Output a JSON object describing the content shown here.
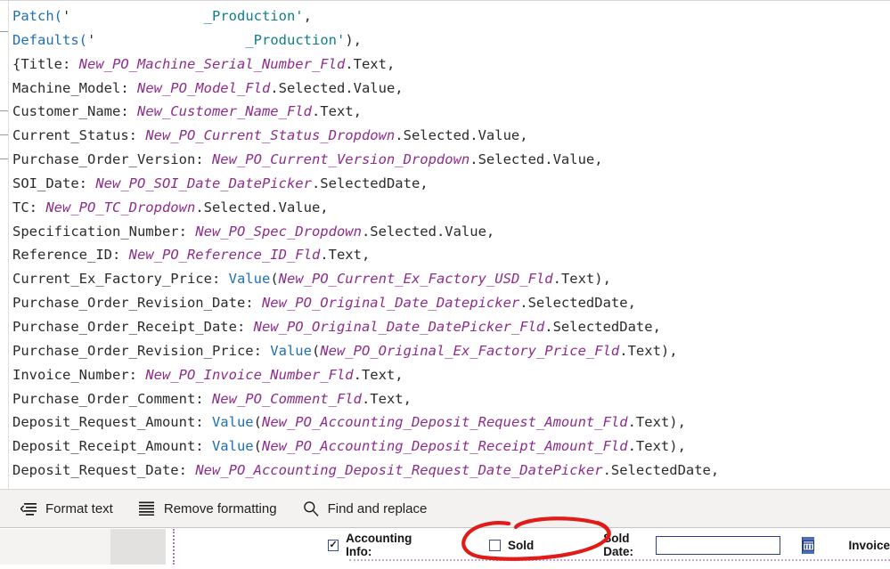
{
  "app": {
    "surface": "powerapps-formula-bar"
  },
  "formula": {
    "language": "Power Fx",
    "lines": [
      [
        {
          "t": "Patch(",
          "c": "fn"
        },
        {
          "t": "'",
          "c": "plain"
        },
        {
          "t": "                ",
          "c": "redact"
        },
        {
          "t": "_Production'",
          "c": "str"
        },
        {
          "t": ",",
          "c": "plain"
        }
      ],
      [
        {
          "t": "Defaults(",
          "c": "fn"
        },
        {
          "t": "'",
          "c": "plain"
        },
        {
          "t": "                  ",
          "c": "redact"
        },
        {
          "t": "_Production'",
          "c": "str"
        },
        {
          "t": "),",
          "c": "plain"
        }
      ],
      [
        {
          "t": "{Title: ",
          "c": "plain"
        },
        {
          "t": "New_PO_Machine_Serial_Number_Fld",
          "c": "ident"
        },
        {
          "t": ".Text,",
          "c": "plain"
        }
      ],
      [
        {
          "t": "Machine_Model: ",
          "c": "plain"
        },
        {
          "t": "New_PO_Model_Fld",
          "c": "ident"
        },
        {
          "t": ".Selected.Value,",
          "c": "plain"
        }
      ],
      [
        {
          "t": "Customer_Name: ",
          "c": "plain"
        },
        {
          "t": "New_Customer_Name_Fld",
          "c": "ident"
        },
        {
          "t": ".Text,",
          "c": "plain"
        }
      ],
      [
        {
          "t": "Current_Status: ",
          "c": "plain"
        },
        {
          "t": "New_PO_Current_Status_Dropdown",
          "c": "ident"
        },
        {
          "t": ".Selected.Value,",
          "c": "plain"
        }
      ],
      [
        {
          "t": "Purchase_Order_Version: ",
          "c": "plain"
        },
        {
          "t": "New_PO_Current_Version_Dropdown",
          "c": "ident"
        },
        {
          "t": ".Selected.Value,",
          "c": "plain"
        }
      ],
      [
        {
          "t": "SOI_Date: ",
          "c": "plain"
        },
        {
          "t": "New_PO_SOI_Date_DatePicker",
          "c": "ident"
        },
        {
          "t": ".SelectedDate,",
          "c": "plain"
        }
      ],
      [
        {
          "t": "TC: ",
          "c": "plain"
        },
        {
          "t": "New_PO_TC_Dropdown",
          "c": "ident"
        },
        {
          "t": ".Selected.Value,",
          "c": "plain"
        }
      ],
      [
        {
          "t": "Specification_Number: ",
          "c": "plain"
        },
        {
          "t": "New_PO_Spec_Dropdown",
          "c": "ident"
        },
        {
          "t": ".Selected.Value,",
          "c": "plain"
        }
      ],
      [
        {
          "t": "Reference_ID: ",
          "c": "plain"
        },
        {
          "t": "New_PO_Reference_ID_Fld",
          "c": "ident"
        },
        {
          "t": ".Text,",
          "c": "plain"
        }
      ],
      [
        {
          "t": "Current_Ex_Factory_Price: ",
          "c": "plain"
        },
        {
          "t": "Value",
          "c": "fn"
        },
        {
          "t": "(",
          "c": "plain"
        },
        {
          "t": "New_PO_Current_Ex_Factory_USD_Fld",
          "c": "ident"
        },
        {
          "t": ".Text),",
          "c": "plain"
        }
      ],
      [
        {
          "t": "Purchase_Order_Revision_Date: ",
          "c": "plain"
        },
        {
          "t": "New_PO_Original_Date_Datepicker",
          "c": "ident"
        },
        {
          "t": ".SelectedDate,",
          "c": "plain"
        }
      ],
      [
        {
          "t": "Purchase_Order_Receipt_Date: ",
          "c": "plain"
        },
        {
          "t": "New_PO_Original_Date_DatePicker_Fld",
          "c": "ident"
        },
        {
          "t": ".SelectedDate,",
          "c": "plain"
        }
      ],
      [
        {
          "t": "Purchase_Order_Revision_Price: ",
          "c": "plain"
        },
        {
          "t": "Value",
          "c": "fn"
        },
        {
          "t": "(",
          "c": "plain"
        },
        {
          "t": "New_PO_Original_Ex_Factory_Price_Fld",
          "c": "ident"
        },
        {
          "t": ".Text),",
          "c": "plain"
        }
      ],
      [
        {
          "t": "Invoice_Number: ",
          "c": "plain"
        },
        {
          "t": "New_PO_Invoice_Number_Fld",
          "c": "ident"
        },
        {
          "t": ".Text,",
          "c": "plain"
        }
      ],
      [
        {
          "t": "Purchase_Order_Comment: ",
          "c": "plain"
        },
        {
          "t": "New_PO_Comment_Fld",
          "c": "ident"
        },
        {
          "t": ".Text,",
          "c": "plain"
        }
      ],
      [
        {
          "t": "Deposit_Request_Amount: ",
          "c": "plain"
        },
        {
          "t": "Value",
          "c": "fn"
        },
        {
          "t": "(",
          "c": "plain"
        },
        {
          "t": "New_PO_Accounting_Deposit_Request_Amount_Fld",
          "c": "ident"
        },
        {
          "t": ".Text),",
          "c": "plain"
        }
      ],
      [
        {
          "t": "Deposit_Receipt_Amount: ",
          "c": "plain"
        },
        {
          "t": "Value",
          "c": "fn"
        },
        {
          "t": "(",
          "c": "plain"
        },
        {
          "t": "New_PO_Accounting_Deposit_Receipt_Amount_Fld",
          "c": "ident"
        },
        {
          "t": ".Text),",
          "c": "plain"
        }
      ],
      [
        {
          "t": "Deposit_Request_Date: ",
          "c": "plain"
        },
        {
          "t": "New_PO_Accounting_Deposit_Request_Date_DatePicker",
          "c": "ident"
        },
        {
          "t": ".SelectedDate,",
          "c": "plain"
        }
      ]
    ]
  },
  "command_bar": {
    "items": [
      {
        "label": "Format text",
        "icon": "format-text-icon"
      },
      {
        "label": "Remove formatting",
        "icon": "remove-formatting-icon"
      },
      {
        "label": "Find and replace",
        "icon": "search-icon"
      }
    ]
  },
  "form": {
    "accounting_info": {
      "label": "Accounting Info:",
      "checked": true,
      "check_glyph": "✓"
    },
    "sold": {
      "label": "Sold",
      "checked": false,
      "check_glyph": ""
    },
    "sold_date": {
      "label": "Sold Date:",
      "value": "",
      "placeholder": "",
      "picker_icon": "calendar-icon"
    },
    "invoice": {
      "label": "Invoice"
    }
  },
  "annotation": {
    "kind": "freehand-circle",
    "color": "#E01B18",
    "targets": "sold-checkbox"
  },
  "colors": {
    "function": "#1f6fb4",
    "string": "#0f7d8c",
    "identifier": "#8e2c8e",
    "plain": "#2b2b2b",
    "command_bar_bg": "#f3f2f1",
    "annotation_red": "#E01B18"
  }
}
